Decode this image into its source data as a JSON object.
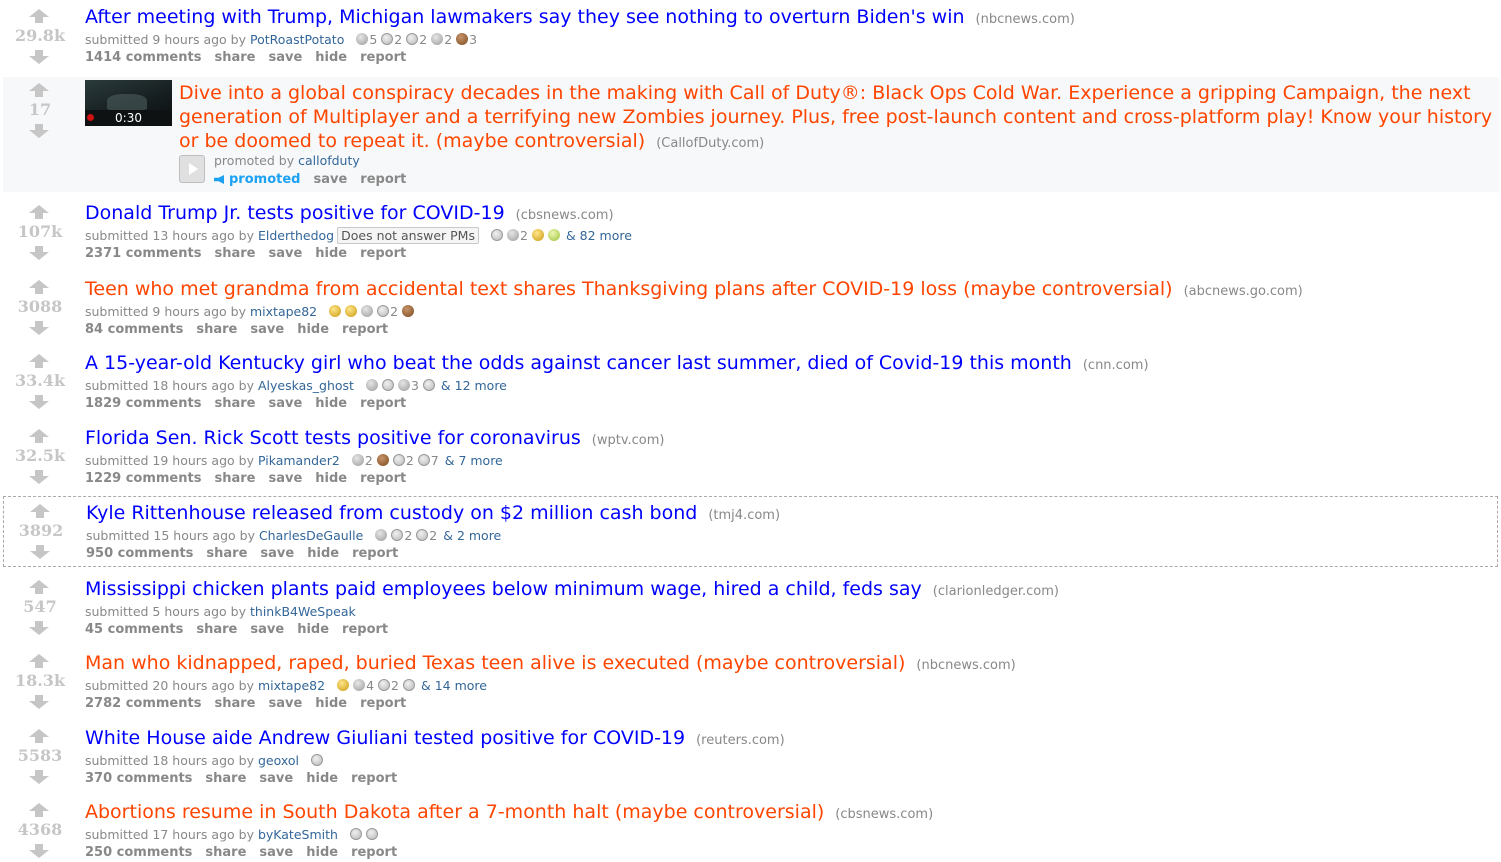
{
  "posts": [
    {
      "score": "29.8k",
      "title": "After meeting with Trump, Michigan lawmakers say they see nothing to overturn Biden's win",
      "domain": "(nbcnews.com)",
      "time": "submitted 9 hours ago by",
      "author": "PotRoastPotato",
      "flair": "",
      "awards": [
        {
          "icon": "silver-award-icon",
          "count": "5"
        },
        {
          "icon": "helpful-award-icon",
          "count": "2"
        },
        {
          "icon": "wholesome-award-icon",
          "count": "2"
        },
        {
          "icon": "money-award-icon",
          "count": "2"
        },
        {
          "icon": "bronze-award-icon",
          "count": "3"
        }
      ],
      "more": "",
      "comments": "1414 comments",
      "share": "share",
      "save": "save",
      "hide": "hide",
      "report": "report"
    },
    {
      "score": "107k",
      "title": "Donald Trump Jr. tests positive for COVID-19",
      "domain": "(cbsnews.com)",
      "time": "submitted 13 hours ago by",
      "author": "Elderthedog",
      "flair": "Does not answer PMs",
      "awards": [
        {
          "icon": "facepalm-award-icon",
          "count": ""
        },
        {
          "icon": "silver-award-icon",
          "count": "2"
        },
        {
          "icon": "gold-award-icon",
          "count": ""
        },
        {
          "icon": "gleam-award-icon",
          "count": ""
        }
      ],
      "more": "& 82 more",
      "comments": "2371 comments",
      "share": "share",
      "save": "save",
      "hide": "hide",
      "report": "report"
    },
    {
      "score": "3088",
      "title": "Teen who met grandma from accidental text shares Thanksgiving plans after COVID-19 loss (maybe controversial)",
      "domain": "(abcnews.go.com)",
      "time": "submitted 9 hours ago by",
      "author": "mixtape82",
      "flair": "",
      "awards": [
        {
          "icon": "smile-award-icon",
          "count": ""
        },
        {
          "icon": "gold-award-icon",
          "count": ""
        },
        {
          "icon": "silver-award-icon",
          "count": ""
        },
        {
          "icon": "wholesome-award-icon",
          "count": "2"
        },
        {
          "icon": "bronze-award-icon",
          "count": ""
        }
      ],
      "more": "",
      "comments": "84 comments",
      "share": "share",
      "save": "save",
      "hide": "hide",
      "report": "report"
    },
    {
      "score": "33.4k",
      "title": "A 15-year-old Kentucky girl who beat the odds against cancer last summer, died of Covid-19 this month",
      "domain": "(cnn.com)",
      "time": "submitted 18 hours ago by",
      "author": "Alyeskas_ghost",
      "flair": "",
      "awards": [
        {
          "icon": "silver-award-icon",
          "count": ""
        },
        {
          "icon": "helpful-award-icon",
          "count": ""
        },
        {
          "icon": "money-award-icon",
          "count": "3"
        },
        {
          "icon": "hug-award-icon",
          "count": ""
        }
      ],
      "more": "& 12 more",
      "comments": "1829 comments",
      "share": "share",
      "save": "save",
      "hide": "hide",
      "report": "report"
    },
    {
      "score": "32.5k",
      "title": "Florida Sen. Rick Scott tests positive for coronavirus",
      "domain": "(wptv.com)",
      "time": "submitted 19 hours ago by",
      "author": "Pikamander2",
      "flair": "",
      "awards": [
        {
          "icon": "silver-award-icon",
          "count": "2"
        },
        {
          "icon": "face-award-icon",
          "count": ""
        },
        {
          "icon": "helpful-award-icon",
          "count": "2"
        },
        {
          "icon": "wholesome-award-icon",
          "count": "7"
        }
      ],
      "more": "& 7 more",
      "comments": "1229 comments",
      "share": "share",
      "save": "save",
      "hide": "hide",
      "report": "report"
    },
    {
      "score": "3892",
      "title": "Kyle Rittenhouse released from custody on $2 million cash bond",
      "domain": "(tmj4.com)",
      "time": "submitted 15 hours ago by",
      "author": "CharlesDeGaulle",
      "flair": "",
      "awards": [
        {
          "icon": "silver-award-icon",
          "count": ""
        },
        {
          "icon": "helpful-award-icon",
          "count": "2"
        },
        {
          "icon": "wholesome-award-icon",
          "count": "2"
        }
      ],
      "more": "& 2 more",
      "comments": "950 comments",
      "share": "share",
      "save": "save",
      "hide": "hide",
      "report": "report"
    },
    {
      "score": "547",
      "title": "Mississippi chicken plants paid employees below minimum wage, hired a child, feds say",
      "domain": "(clarionledger.com)",
      "time": "submitted 5 hours ago by",
      "author": "thinkB4WeSpeak",
      "flair": "",
      "awards": [],
      "more": "",
      "comments": "45 comments",
      "share": "share",
      "save": "save",
      "hide": "hide",
      "report": "report"
    },
    {
      "score": "18.3k",
      "title": "Man who kidnapped, raped, buried Texas teen alive is executed (maybe controversial)",
      "domain": "(nbcnews.com)",
      "time": "submitted 20 hours ago by",
      "author": "mixtape82",
      "flair": "",
      "awards": [
        {
          "icon": "sad-award-icon",
          "count": ""
        },
        {
          "icon": "silver-award-icon",
          "count": "4"
        },
        {
          "icon": "helpful-award-icon",
          "count": "2"
        },
        {
          "icon": "dog-award-icon",
          "count": ""
        }
      ],
      "more": "& 14 more",
      "comments": "2782 comments",
      "share": "share",
      "save": "save",
      "hide": "hide",
      "report": "report"
    },
    {
      "score": "5583",
      "title": "White House aide Andrew Giuliani tested positive for COVID-19",
      "domain": "(reuters.com)",
      "time": "submitted 18 hours ago by",
      "author": "geoxol",
      "flair": "",
      "awards": [
        {
          "icon": "facepalm-award-icon",
          "count": ""
        }
      ],
      "more": "",
      "comments": "370 comments",
      "share": "share",
      "save": "save",
      "hide": "hide",
      "report": "report"
    },
    {
      "score": "4368",
      "title": "Abortions resume in South Dakota after a 7-month halt (maybe controversial)",
      "domain": "(cbsnews.com)",
      "time": "submitted 17 hours ago by",
      "author": "byKateSmith",
      "flair": "",
      "awards": [
        {
          "icon": "helpful-award-icon",
          "count": ""
        },
        {
          "icon": "wholesome-award-icon",
          "count": ""
        }
      ],
      "more": "",
      "comments": "250 comments",
      "share": "share",
      "save": "save",
      "hide": "hide",
      "report": "report"
    }
  ],
  "promoted": {
    "score": "17",
    "duration": "0:30",
    "title": "Dive into a global conspiracy decades in the making with Call of Duty®: Black Ops Cold War. Experience a gripping Campaign, the next generation of Multiplayer and a terrifying new Zombies journey. Plus, free post-launch content and cross-platform play! Know your history or be doomed to repeat it. (maybe controversial)",
    "domain": "(CallofDuty.com)",
    "promoted_by": "promoted by",
    "author": "callofduty",
    "promoted_label": "promoted",
    "save": "save",
    "report": "report"
  },
  "colors": {
    "link": "#0000ff",
    "controversial": "#ff4500",
    "author": "#336699",
    "meta": "#888888",
    "vote": "#c6c6c6",
    "promoted_blue": "#1da1f2"
  }
}
